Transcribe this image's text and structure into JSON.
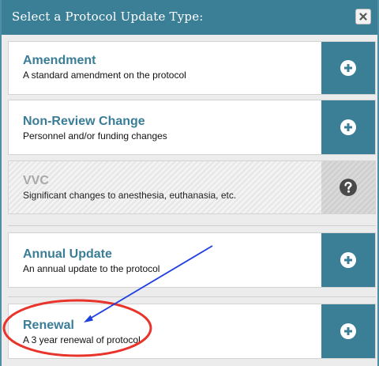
{
  "dialog": {
    "title": "Select a Protocol Update Type:",
    "close_icon": "close-x-icon"
  },
  "options": [
    {
      "name": "Amendment",
      "description": "A standard amendment on the protocol",
      "icon": "plus-circle-icon",
      "enabled": true
    },
    {
      "name": "Non-Review Change",
      "description": "Personnel and/or funding changes",
      "icon": "plus-circle-icon",
      "enabled": true
    },
    {
      "name": "VVC",
      "description": "Significant changes to anesthesia, euthanasia, etc.",
      "icon": "question-circle-icon",
      "enabled": false
    },
    {
      "name": "Annual Update",
      "description": "An annual update to the protocol",
      "icon": "plus-circle-icon",
      "enabled": true
    },
    {
      "name": "Renewal",
      "description": "A 3 year renewal of protocol",
      "icon": "plus-circle-icon",
      "enabled": true
    }
  ],
  "colors": {
    "header": "#3b7f97",
    "option_name": "#3a7d96",
    "annotation_circle": "#e8342a",
    "annotation_arrow": "#1f3fe0"
  }
}
